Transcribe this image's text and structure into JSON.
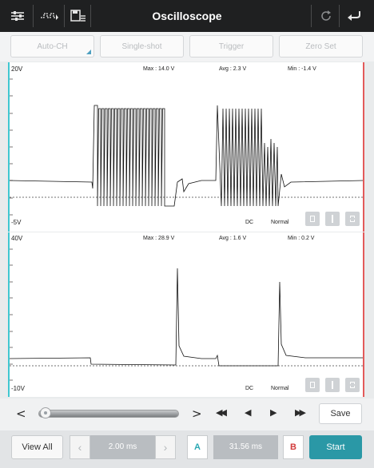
{
  "app": {
    "title": "Oscilloscope",
    "icons": [
      "sliders-icon",
      "waveform-icon",
      "save-file-icon",
      "refresh-icon",
      "back-icon"
    ]
  },
  "mode_buttons": [
    {
      "label": "Auto-CH",
      "disabled": true
    },
    {
      "label": "Single-shot",
      "disabled": true
    },
    {
      "label": "Trigger",
      "disabled": true
    },
    {
      "label": "Zero Set",
      "disabled": true
    }
  ],
  "channel1": {
    "top_label": "20V",
    "bottom_label": "-5V",
    "max": "Max : 14.0 V",
    "avg": "Avg : 2.3 V",
    "min": "Min : -1.4 V",
    "coupling": "DC",
    "mode": "Normal"
  },
  "channel2": {
    "top_label": "40V",
    "bottom_label": "-10V",
    "max": "Max : 28.9 V",
    "avg": "Avg : 1.6 V",
    "min": "Min : 0.2 V",
    "coupling": "DC",
    "mode": "Normal"
  },
  "navigation": {
    "prev": "<",
    "next": ">",
    "fast_back": "◀◀",
    "step_back": "◀",
    "step_fwd": "▶",
    "fast_fwd": "▶▶",
    "save": "Save"
  },
  "bottom": {
    "view_all": "View All",
    "time_scale": "2.00 ms",
    "cursor_a": "A",
    "cursor_delta": "31.56 ms",
    "cursor_b": "B",
    "start": "Start"
  },
  "colors": {
    "accent_teal": "#2a98a6",
    "cursor_a": "#40c7d1",
    "cursor_b": "#e35a5a"
  }
}
